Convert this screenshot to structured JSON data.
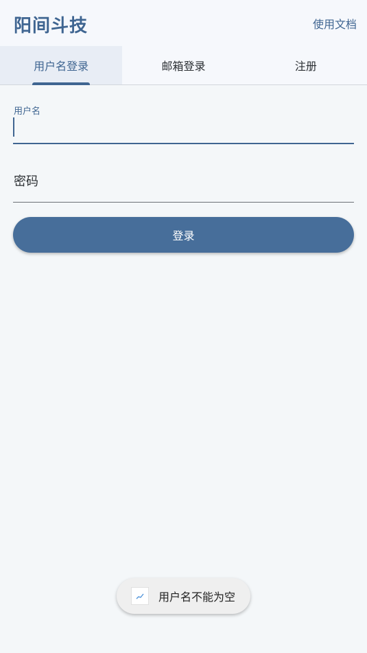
{
  "header": {
    "title": "阳间斗技",
    "docs_link": "使用文档"
  },
  "tabs": [
    {
      "label": "用户名登录",
      "active": true
    },
    {
      "label": "邮箱登录",
      "active": false
    },
    {
      "label": "注册",
      "active": false
    }
  ],
  "form": {
    "username_label": "用户名",
    "username_value": "",
    "password_placeholder": "密码",
    "login_button": "登录"
  },
  "toast": {
    "message": "用户名不能为空",
    "icon": "chart-trend-icon"
  },
  "colors": {
    "primary": "#3f6591",
    "button": "#476e9a",
    "background": "#f4f7f9"
  }
}
